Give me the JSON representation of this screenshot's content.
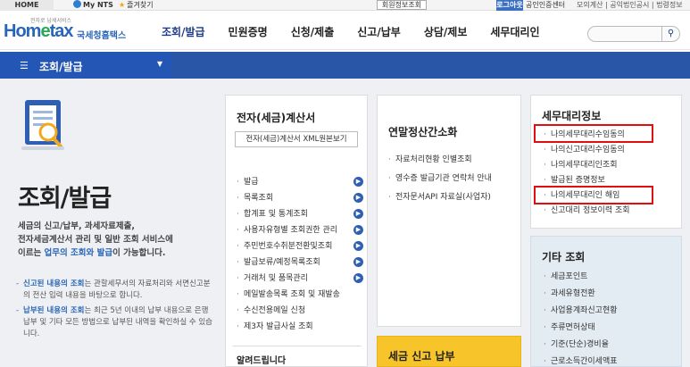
{
  "topbar": {
    "home": "HOME",
    "mynts": "My NTS",
    "favorites": "즐겨찾기",
    "login_info": "회원정보조회",
    "logout": "로그아웃",
    "cert_center": "공인인증센터",
    "right_links": "모의계산 | 공익법인공시 | 법령정보"
  },
  "header": {
    "logo_small": "전자로 납세서비스",
    "logo_word_a": "Hom",
    "logo_word_e": "e",
    "logo_word_b": "tax",
    "logo_kname": "국세청홈택스",
    "gnb": [
      "조회/발급",
      "민원증명",
      "신청/제출",
      "신고/납부",
      "상담/제보",
      "세무대리인"
    ],
    "search_placeholder": ""
  },
  "nav": {
    "label": "조회/발급"
  },
  "left": {
    "title": "조회/발급",
    "intro_1": "세금의 신고/납부, 과세자료제출,",
    "intro_2": "전자세금계산서 관리 및 일반 조회 서비스에",
    "intro_3a": "이르는 ",
    "intro_3b": "업무의 조회와 발급",
    "intro_3c": "이 가능합니다.",
    "note1_b": "신고된 내용의 조회",
    "note1_r": "는 관할세무서의 자료처리와 서면신고분의 전산 입력 내용을 바탕으로 합니다.",
    "note2_b": "납부된 내용의 조회",
    "note2_r": "는 최근 5년 이내의 납부 내용으로 은행 납부 및 기타 모든 방법으로 납부된 내역을 확인하실 수 있습니다."
  },
  "panel1": {
    "title": "전자(세금)계산서",
    "doc_button": "전자(세금)계산서 XML원본보기",
    "items": [
      "발급",
      "목록조회",
      "합계표 및 통계조회",
      "사용자유형별 조회권한 관리",
      "주민번호수취분전환및조회",
      "발급보류/예정목록조회",
      "거래처 및 품목관리",
      "메일발송목록 조회 및 재발송",
      "수신전용메일 신청",
      "제3자 발급사실 조회"
    ],
    "arrows": [
      true,
      true,
      true,
      true,
      true,
      true,
      true,
      false,
      false,
      false
    ],
    "more": "알려드립니다"
  },
  "panel2": {
    "title": "연말정산간소화",
    "items": [
      "자료처리현황 인별조회",
      "영수증 발급기관 연락처 안내",
      "전자문서API 자료실(사업자)"
    ]
  },
  "panel3": {
    "title": "세무대리정보",
    "items": [
      "나의세무대리수임동의",
      "나의신고대리수임동의",
      "나의세무대리인조회",
      "발급된 증명정보",
      "나의세무대리인 해임",
      "신고대리 정보이력 조회"
    ]
  },
  "panel4": {
    "title": "기타 조회",
    "items": [
      "세금포인트",
      "과세유형전환",
      "사업용계좌신고현황",
      "주류면허상태",
      "기준(단순)경비율",
      "근로소득간이세액표"
    ]
  },
  "panel5": {
    "title": "세금 신고 납부"
  }
}
